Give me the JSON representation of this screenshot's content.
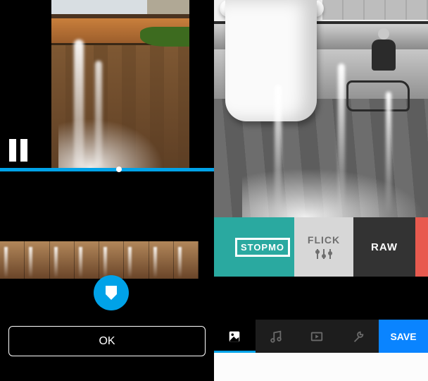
{
  "left": {
    "ok_label": "OK",
    "timeline_progress_pct": 48,
    "player_state": "paused",
    "filmstrip_frames": 8
  },
  "right": {
    "filters": {
      "stopmo": "STOPMO",
      "flick": "FLICK",
      "raw": "RAW",
      "selected": "flick"
    },
    "save_label": "SAVE",
    "tabs": [
      "styles",
      "music",
      "video",
      "tools"
    ],
    "active_tab": "styles"
  },
  "colors": {
    "accent": "#00a2e8",
    "save": "#0a84ff",
    "teal": "#2aa9a0",
    "raw_bg": "#333333",
    "flick_bg": "#d7d7d7"
  },
  "watermark": ""
}
